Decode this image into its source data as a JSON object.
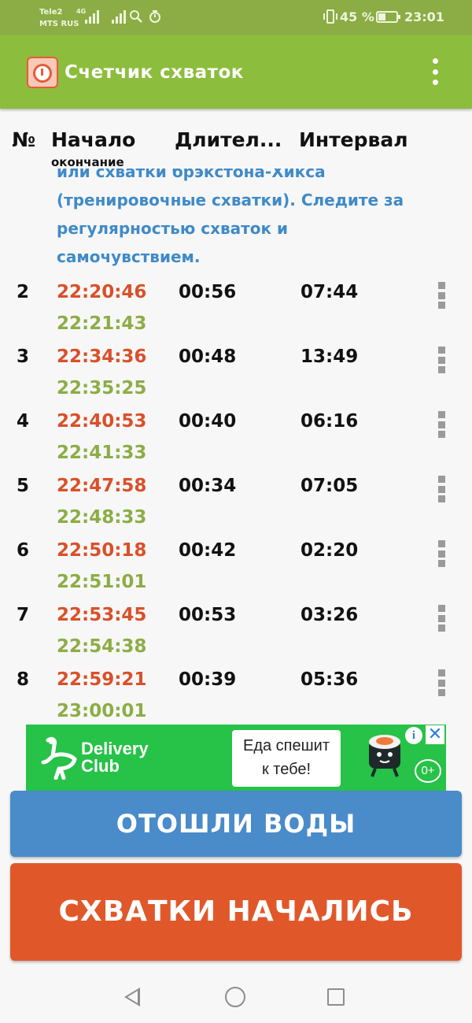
{
  "status_bar": {
    "carrier1": "Tele2",
    "carrier2": "MTS RUS",
    "network": "4G",
    "battery_percent": "45 %",
    "battery_level": 0.45,
    "time": "23:01",
    "icons": [
      "signal-icon",
      "search-icon",
      "timer-icon",
      "vibrate-icon",
      "battery-icon"
    ]
  },
  "app_bar": {
    "title": "Счетчик схваток",
    "logo_icon": "stopwatch-logo",
    "menu_icon": "more-vertical-icon"
  },
  "columns": {
    "number": "№",
    "start": "Начало",
    "duration": "Длител...",
    "interval": "Интервал",
    "end_sub": "окончание"
  },
  "note": {
    "text": "или схватки брэкстона-Хикса (тренировочные схватки). Следите за регулярностью схваток и самочувствием."
  },
  "rows": [
    {
      "num": "2",
      "start": "22:20:46",
      "end": "22:21:43",
      "duration": "00:56",
      "interval": "07:44"
    },
    {
      "num": "3",
      "start": "22:34:36",
      "end": "22:35:25",
      "duration": "00:48",
      "interval": "13:49"
    },
    {
      "num": "4",
      "start": "22:40:53",
      "end": "22:41:33",
      "duration": "00:40",
      "interval": "06:16"
    },
    {
      "num": "5",
      "start": "22:47:58",
      "end": "22:48:33",
      "duration": "00:34",
      "interval": "07:05"
    },
    {
      "num": "6",
      "start": "22:50:18",
      "end": "22:51:01",
      "duration": "00:42",
      "interval": "02:20"
    },
    {
      "num": "7",
      "start": "22:53:45",
      "end": "22:54:38",
      "duration": "00:53",
      "interval": "03:26"
    },
    {
      "num": "8",
      "start": "22:59:21",
      "end": "23:00:01",
      "duration": "00:39",
      "interval": "05:36"
    }
  ],
  "ad": {
    "brand_line1": "Delivery",
    "brand_line2": "Club",
    "bubble_line1": "Еда спешит",
    "bubble_line2": "к тебе!",
    "info_label": "i",
    "close_label": "✕",
    "age_rating": "0+"
  },
  "buttons": {
    "water": "ОТОШЛИ ВОДЫ",
    "start": "СХВАТКИ НАЧАЛИСЬ"
  },
  "colors": {
    "app_bar": "#8cbd3c",
    "start_time": "#d9502a",
    "end_time": "#8cad45",
    "note_text": "#3f8ac8",
    "water_button": "#4a8bca",
    "start_button": "#e0582a"
  }
}
